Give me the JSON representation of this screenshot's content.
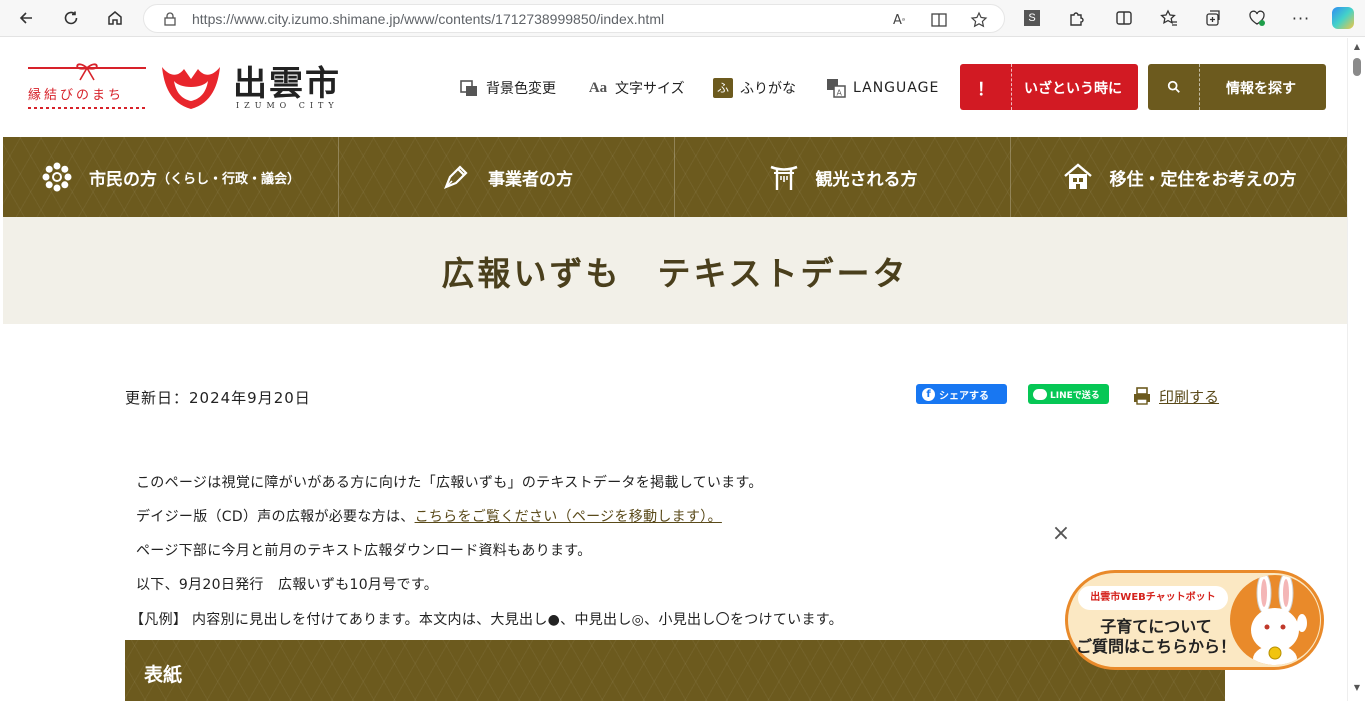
{
  "browser": {
    "url": "https://www.city.izumo.shimane.jp/www/contents/1712738999850/index.html"
  },
  "header": {
    "tagline": "縁結びのまち",
    "city_name": "出雲市",
    "city_name_en": "IZUMO CITY",
    "tools": [
      {
        "label": "背景色変更",
        "icon": "palette-icon"
      },
      {
        "label": "文字サイズ",
        "icon": "text-size-icon"
      },
      {
        "label": "ふりがな",
        "icon": "furigana-icon"
      },
      {
        "label": "LANGUAGE",
        "icon": "language-icon"
      }
    ],
    "emergency_mark": "！",
    "emergency_label": "いざという時に",
    "search_label": "情報を探す"
  },
  "nav": {
    "items": [
      {
        "label": "市民の方",
        "sub": "（くらし・行政・議会）",
        "icon": "chrysanthemum-icon"
      },
      {
        "label": "事業者の方",
        "sub": "",
        "icon": "pen-icon"
      },
      {
        "label": "観光される方",
        "sub": "",
        "icon": "torii-icon"
      },
      {
        "label": "移住・定住をお考えの方",
        "sub": "",
        "icon": "house-icon"
      }
    ]
  },
  "page": {
    "title": "広報いずも　テキストデータ",
    "updated": "更新日：2024年9月20日",
    "share_facebook": "シェアする",
    "share_line": "LINEで送る",
    "print": "印刷する",
    "paragraphs": [
      "このページは視覚に障がいがある方に向けた「広報いずも」のテキストデータを掲載しています。",
      "デイジー版（CD）声の広報が必要な方は、",
      "ページ下部に今月と前月のテキスト広報ダウンロード資料もあります。",
      "以下、9月20日発行　広報いずも10月号です。",
      "【凡例】 内容別に見出しを付けてあります。本文内は、大見出し●、中見出し◎、小見出し〇をつけています。"
    ],
    "link_text": "こちらをご覧ください（ページを移動します）。",
    "section_heading": "表紙"
  },
  "chatbot": {
    "close": "×",
    "tag": "出雲市WEBチャットボット",
    "line1": "子育てについて",
    "line2": "ご質問はこちらから！"
  },
  "colors": {
    "brand_brown": "#6c5a1e",
    "emergency_red": "#d21a23",
    "title_band": "#f2f0e8",
    "facebook": "#1877f2",
    "line": "#06c755",
    "chat_orange": "#e98a2a"
  }
}
